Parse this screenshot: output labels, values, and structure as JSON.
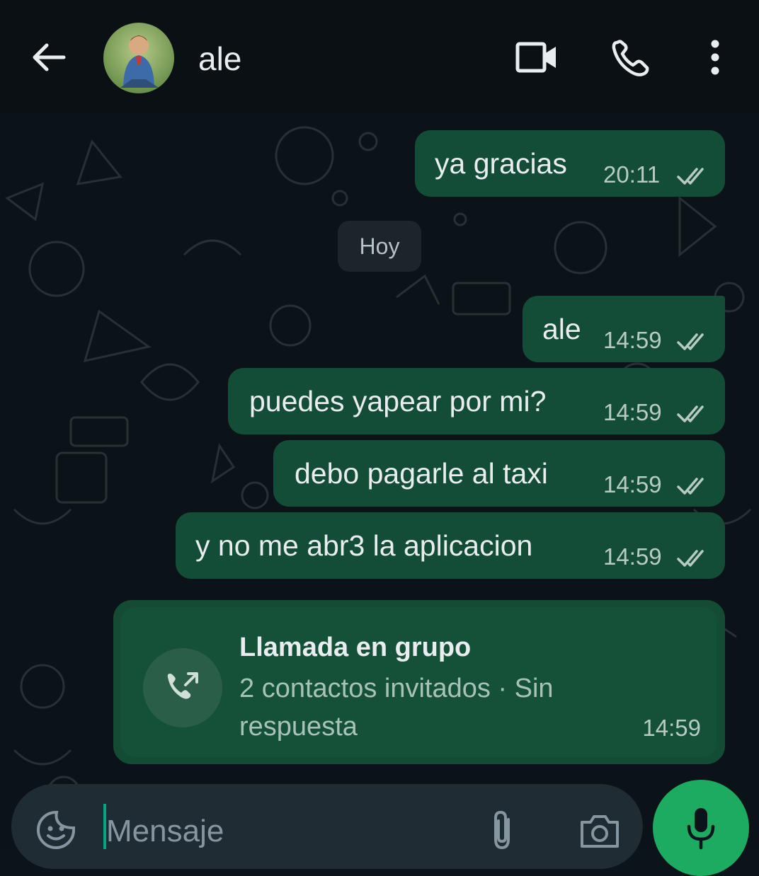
{
  "header": {
    "contact_name": "ale",
    "icons": [
      "back-arrow-icon",
      "avatar",
      "video-call-icon",
      "voice-call-icon",
      "more-options-icon"
    ]
  },
  "messages": [
    {
      "text": "ya gracias",
      "time": "20:11",
      "status": "read"
    },
    {
      "date_separator": "Hoy"
    },
    {
      "text": "ale",
      "time": "14:59",
      "status": "read"
    },
    {
      "text": "puedes yapear por mi?",
      "time": "14:59",
      "status": "read"
    },
    {
      "text": "debo pagarle al taxi",
      "time": "14:59",
      "status": "read"
    },
    {
      "text": "y no me abr3 la aplicacion",
      "time": "14:59",
      "status": "read"
    }
  ],
  "call": {
    "title": "Llamada en grupo",
    "subtitle_line1": "2 contactos invitados · Sin",
    "subtitle_line2": "respuesta",
    "time": "14:59",
    "icon": "outgoing-call-icon"
  },
  "composer": {
    "placeholder": "Mensaje",
    "icons": [
      "sticker-icon",
      "attach-icon",
      "camera-icon",
      "mic-icon"
    ]
  },
  "colors": {
    "background": "#0b141a",
    "outgoing_bubble": "#144d37",
    "accent": "#1daa61",
    "caret": "#00a884"
  }
}
